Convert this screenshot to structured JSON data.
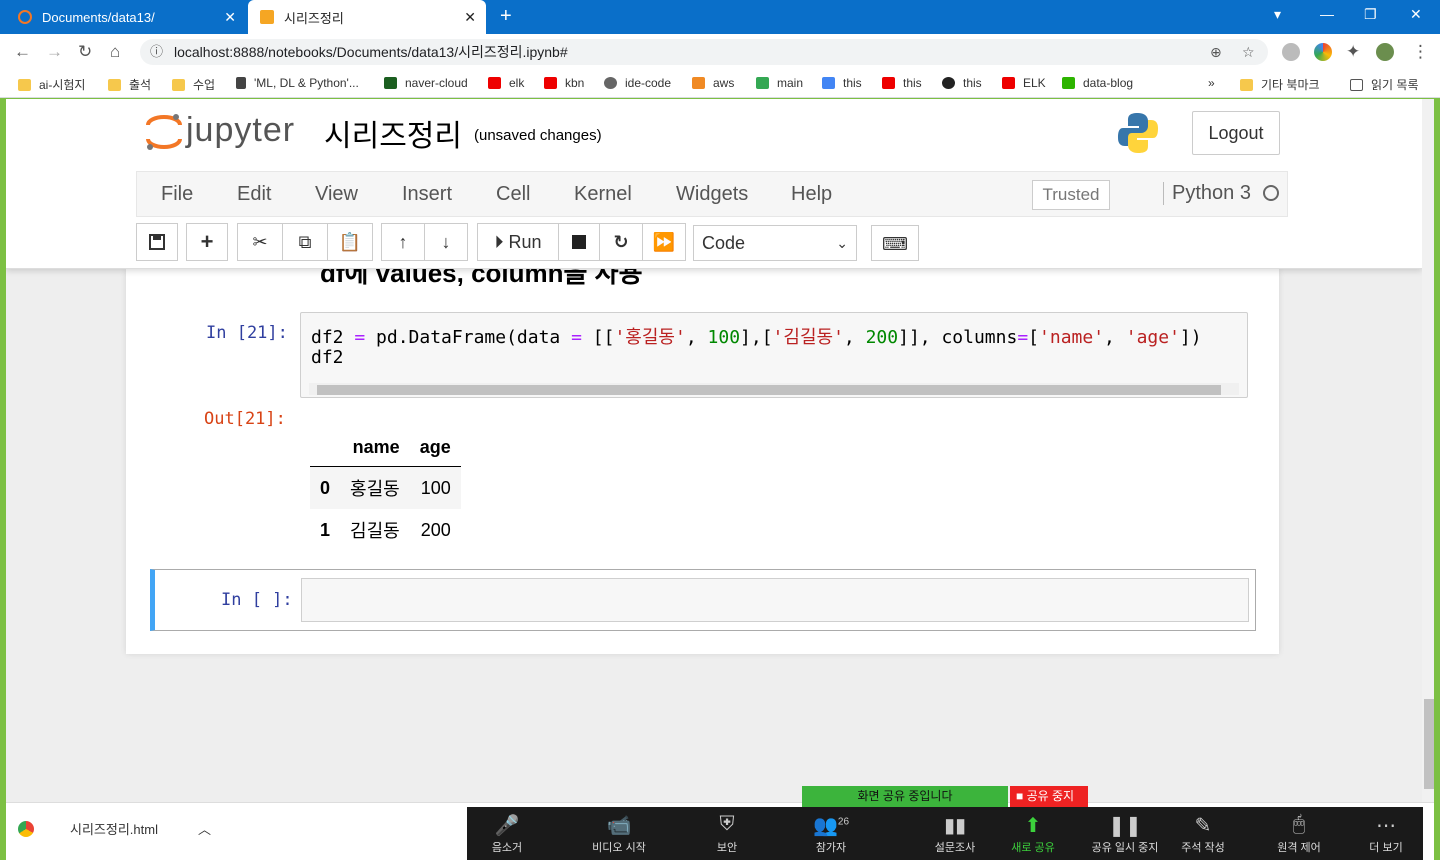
{
  "browser": {
    "tabs": [
      {
        "label": "Documents/data13/",
        "active": false
      },
      {
        "label": "시리즈정리",
        "active": true
      }
    ],
    "url": "localhost:8888/notebooks/Documents/data13/시리즈정리.ipynb#",
    "bookmarks": [
      "ai-시험지",
      "출석",
      "수업",
      "'ML, DL & Python'...",
      "naver-cloud",
      "elk",
      "kbn",
      "ide-code",
      "aws",
      "main",
      "this",
      "this",
      "this",
      "ELK",
      "data-blog"
    ],
    "bookmarks_more": "»",
    "other_bookmarks": "기타 북마크",
    "reading_list": "읽기 목록"
  },
  "jupyter": {
    "brand": "jupyter",
    "title": "시리즈정리",
    "status": "(unsaved changes)",
    "logout": "Logout",
    "menu": [
      "File",
      "Edit",
      "View",
      "Insert",
      "Cell",
      "Kernel",
      "Widgets",
      "Help"
    ],
    "trusted": "Trusted",
    "kernel": "Python 3",
    "run_label": "Run",
    "cell_type": "Code"
  },
  "notebook": {
    "partial_heading": "df에 values, column을 사용",
    "cell1_prompt": "In [21]:",
    "cell1_out_prompt": "Out[21]:",
    "cell1_line2": "df2",
    "df_header": [
      "",
      "name",
      "age"
    ],
    "df_rows": [
      [
        "0",
        "홍길동",
        "100"
      ],
      [
        "1",
        "김길동",
        "200"
      ]
    ],
    "cell2_prompt": "In [ ]:"
  },
  "download": {
    "filename": "시리즈정리.html"
  },
  "zoom": {
    "share_status": "화면 공유 중입니다",
    "stop_share": "공유 중지",
    "participants_count": "26",
    "buttons": [
      "음소거",
      "비디오 시작",
      "보안",
      "참가자",
      "설문조사",
      "새로 공유",
      "공유 일시 중지",
      "주석 작성",
      "원격 제어",
      "더 보기"
    ]
  }
}
